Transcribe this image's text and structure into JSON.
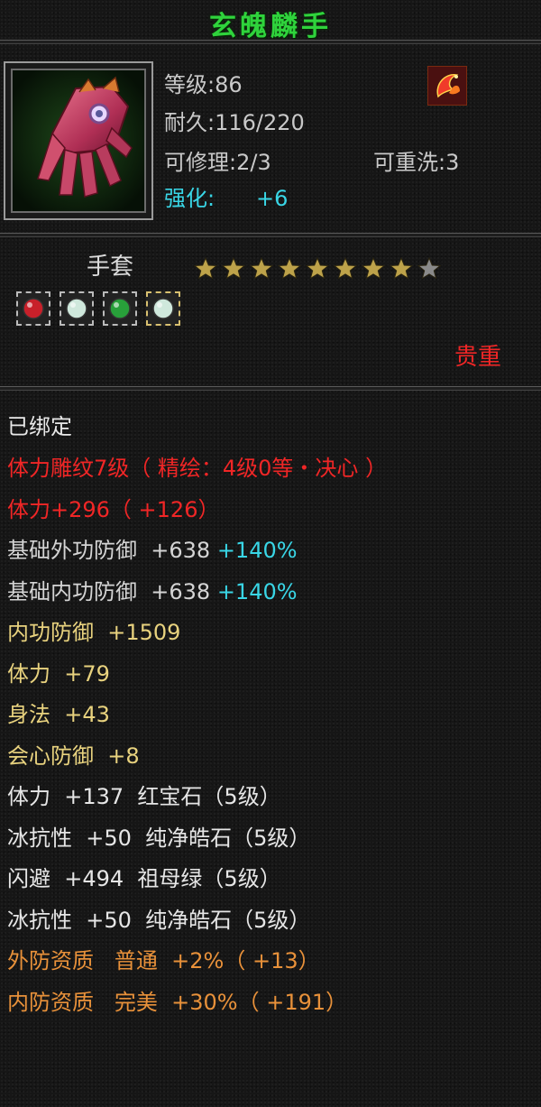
{
  "item": {
    "name": "玄魄麟手",
    "level_label": "等级:86",
    "durability_label": "耐久:116/220",
    "repair_label": "可修理:2/3",
    "reforge_label": "可重洗:3",
    "enhance_label": "强化:",
    "enhance_value": "+6",
    "type": "手套",
    "stars_filled": 8,
    "stars_total": 9,
    "rarity": "贵重",
    "bound": "已绑定"
  },
  "gems": [
    {
      "icon": "ruby-gem-icon",
      "color": "#c8202a"
    },
    {
      "icon": "white-gem-icon",
      "color": "#cfe8dc"
    },
    {
      "icon": "emerald-gem-icon",
      "color": "#28a03a"
    },
    {
      "icon": "white-gem-icon",
      "color": "#cfe8dc"
    }
  ],
  "attributes": [
    {
      "text": "体力雕纹7级（ 精绘：4级0等・决心 ）",
      "color": "red"
    },
    {
      "text": "体力+296（ +126）",
      "color": "red"
    },
    {
      "text": "基础外功防御  +638 ",
      "extra": "+140%",
      "color": "white"
    },
    {
      "text": "基础内功防御  +638 ",
      "extra": "+140%",
      "color": "white"
    },
    {
      "text": "内功防御  +1509",
      "color": "yellow"
    },
    {
      "text": "体力  +79",
      "color": "yellow"
    },
    {
      "text": "身法  +43",
      "color": "yellow"
    },
    {
      "text": "会心防御  +8",
      "color": "yellow"
    },
    {
      "text": "体力  +137  红宝石（5级）",
      "color": "white_yellow"
    },
    {
      "text": "冰抗性  +50  纯净皓石（5级）",
      "color": "white_yellow"
    },
    {
      "text": "闪避  +494  祖母绿（5级）",
      "color": "white_yellow"
    },
    {
      "text": "冰抗性  +50  纯净皓石（5级）",
      "color": "white_yellow"
    },
    {
      "text": "外防资质   普通  +2%（ +13）",
      "color": "orange"
    },
    {
      "text": "内防资质   完美  +30%（ +191）",
      "color": "orange"
    }
  ],
  "colors": {
    "title": "#2fd33c",
    "red": "#f02626",
    "cyan": "#39d6e6",
    "yellow": "#e8d27e",
    "orange": "#e8913a",
    "star_filled": "#bda24a",
    "star_empty": "#8a8a8a"
  }
}
